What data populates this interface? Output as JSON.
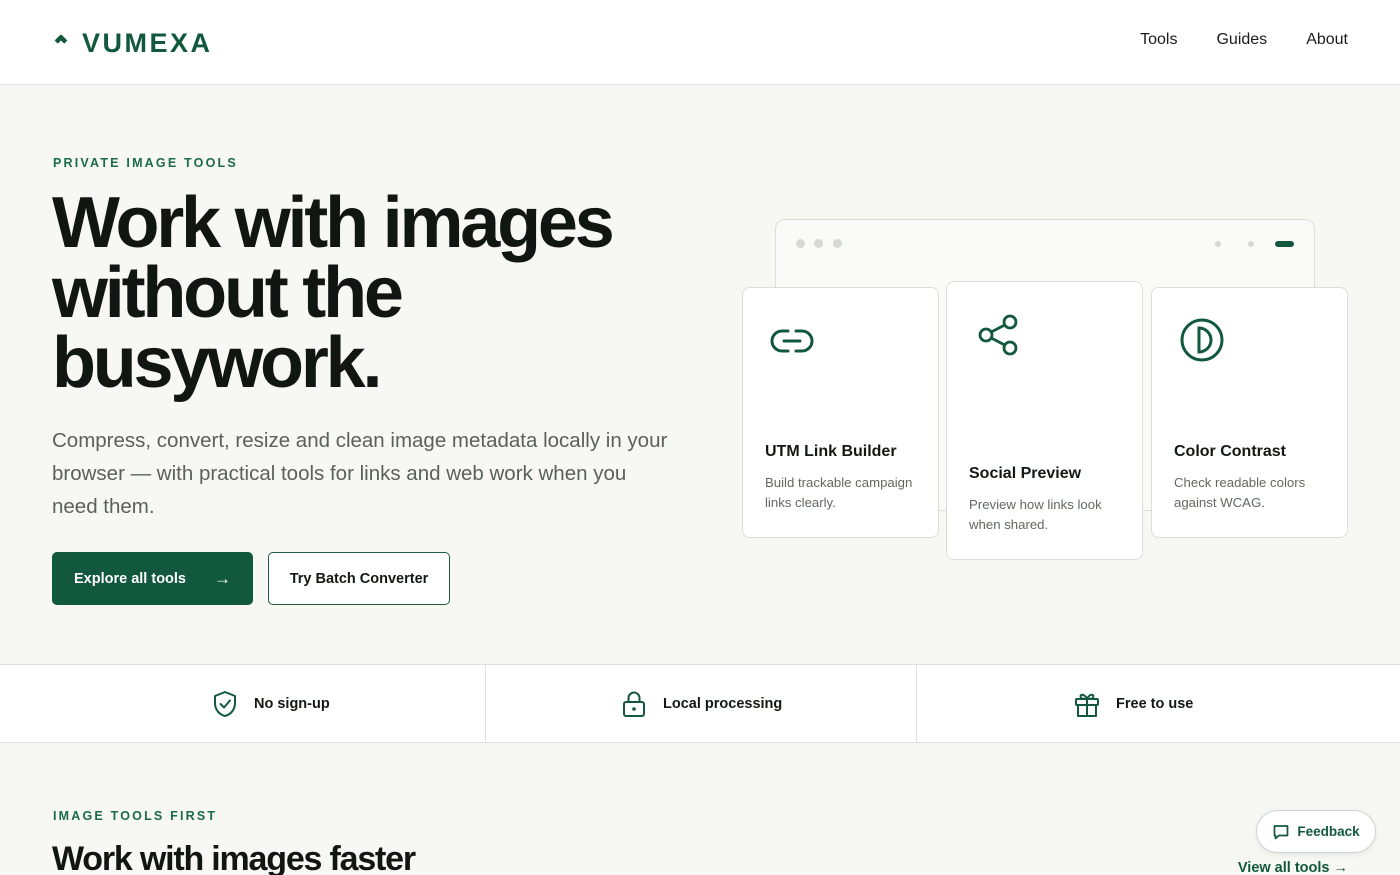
{
  "brand": {
    "name": "VUMEXA",
    "color": "#12583c"
  },
  "nav": {
    "items": [
      "Tools",
      "Guides",
      "About"
    ]
  },
  "hero": {
    "eyebrow": "PRIVATE IMAGE TOOLS",
    "title": "Work with images without the busywork.",
    "subtitle": "Compress, convert, resize and clean image metadata locally in your browser — with practical tools for links and web work when you need them.",
    "primary_cta": "Explore all tools",
    "primary_arrow": "→",
    "secondary_cta": "Try Batch Converter"
  },
  "cards": [
    {
      "icon": "link-icon",
      "title": "UTM Link Builder",
      "desc": "Build trackable campaign links clearly."
    },
    {
      "icon": "share-icon",
      "title": "Social Preview",
      "desc": "Preview how links look when shared."
    },
    {
      "icon": "contrast-icon",
      "title": "Color Contrast",
      "desc": "Check readable colors against WCAG."
    }
  ],
  "features": [
    {
      "icon": "shield-check-icon",
      "label": "No sign-up"
    },
    {
      "icon": "lock-icon",
      "label": "Local processing"
    },
    {
      "icon": "gift-icon",
      "label": "Free to use"
    }
  ],
  "section": {
    "eyebrow": "IMAGE TOOLS FIRST",
    "title": "Work with images faster",
    "view_all": "View all tools →"
  },
  "feedback": {
    "label": "Feedback",
    "icon": "chat-icon"
  }
}
